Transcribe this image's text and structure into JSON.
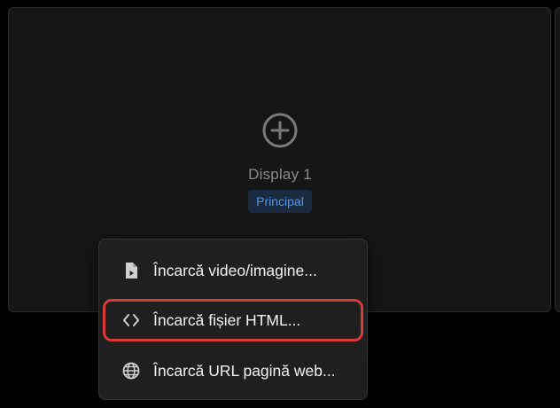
{
  "display": {
    "title": "Display 1",
    "badge": "Principal",
    "add_icon": "plus-circle-icon"
  },
  "menu": {
    "items": [
      {
        "label": "Încarcă video/imagine...",
        "icon": "file-media-icon",
        "highlighted": false
      },
      {
        "label": "Încarcă fișier HTML...",
        "icon": "code-brackets-icon",
        "highlighted": true
      },
      {
        "label": "Încarcă URL pagină web...",
        "icon": "globe-icon",
        "highlighted": false
      }
    ]
  },
  "colors": {
    "background": "#000000",
    "card": "#161616",
    "menu": "#1f1f1f",
    "badge_text": "#4f97e6",
    "badge_bg": "#1a2a40",
    "highlight_outline": "#d83a3a"
  }
}
